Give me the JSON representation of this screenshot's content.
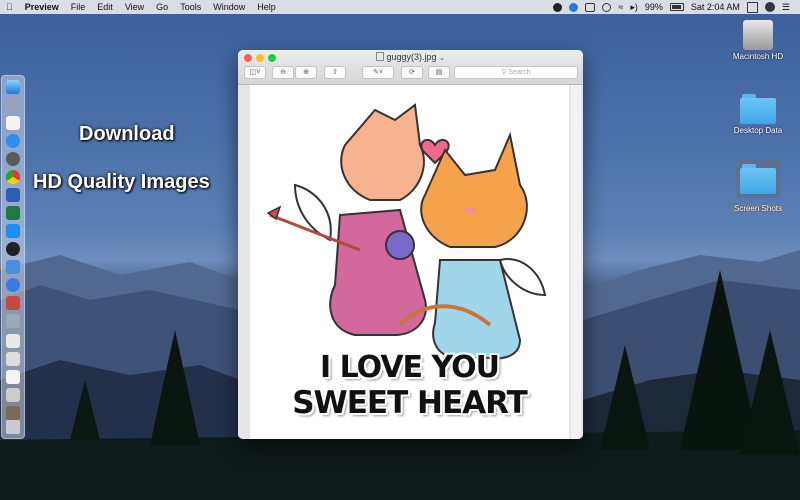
{
  "menubar": {
    "app_name": "Preview",
    "menus": [
      "File",
      "Edit",
      "View",
      "Go",
      "Tools",
      "Window",
      "Help"
    ],
    "battery": "99%",
    "clock": "Sat 2:04 AM"
  },
  "promo": {
    "line1": "Download",
    "line2": "HD Quality Images"
  },
  "desktop_icons": {
    "hd": "Macintosh HD",
    "desktop_data": "Desktop Data",
    "screen_shots": "Screen Shots"
  },
  "window": {
    "title": "guggy(3).jpg",
    "search_placeholder": "Search"
  },
  "image": {
    "caption_line1": "I LOVE YOU",
    "caption_line2": "SWEET HEART"
  },
  "colors": {
    "close": "#fd5f57",
    "minimize": "#febc2e",
    "zoom": "#28c840",
    "folder_blue": "#4ab0ee"
  }
}
